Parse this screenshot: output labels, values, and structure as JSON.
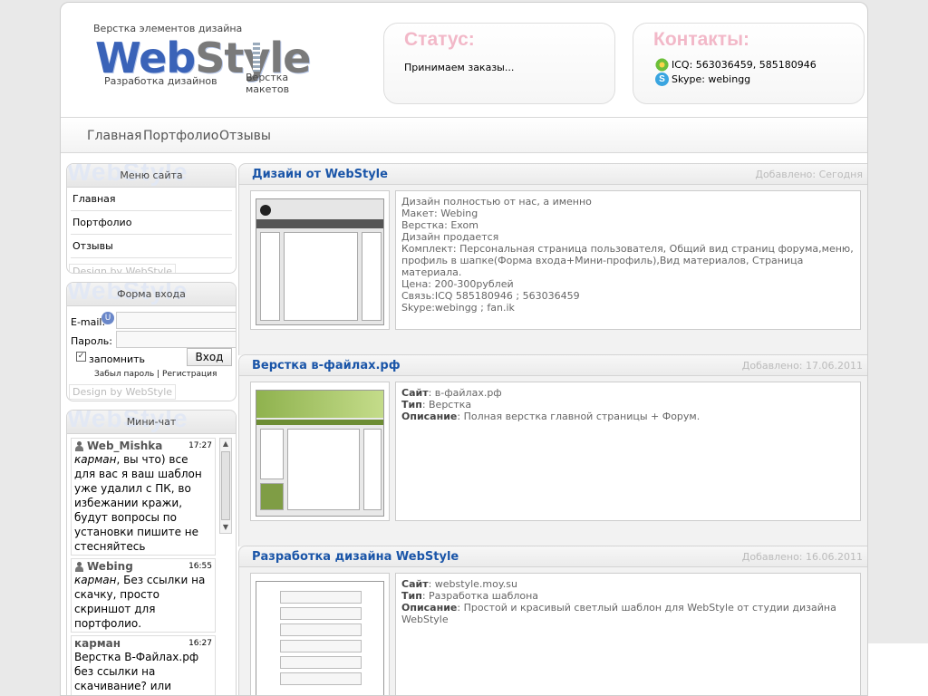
{
  "header": {
    "logo_tag_top": "Верстка элементов дизайна",
    "logo_part1": "Web",
    "logo_part2": "Style",
    "logo_tag_left": "Разработка дизайнов",
    "logo_tag_right": "Верстка макетов",
    "status_title": "Статус:",
    "status_text": "Принимаем заказы...",
    "contacts_title": "Контакты:",
    "contact_icq": "ICQ: 563036459, 585180946",
    "contact_skype": "Skype: webingg"
  },
  "nav": [
    "Главная",
    "Портфолио",
    "Отзывы"
  ],
  "sidebar": {
    "watermark": "WebStyle",
    "menu_title": "Меню сайта",
    "menu_items": [
      "Главная",
      "Портфолио",
      "Отзывы"
    ],
    "design_by": "Design by WebStyle",
    "login_title": "Форма входа",
    "email_label": "E-mail:",
    "password_label": "Пароль:",
    "remember_label": "запомнить",
    "login_button": "Вход",
    "forgot_link": "Забыл пароль",
    "separator": "|",
    "register_link": "Регистрация",
    "chat_title": "Мини-чат",
    "chat": [
      {
        "user": "Web_Mishka",
        "time": "17:27",
        "mention": "карман",
        "text": ", вы что) все для вас я ваш шаблон уже удалил с ПК, во избежании кражи, будут вопросы по установки пишите не стесняйтесь"
      },
      {
        "user": "Webing",
        "time": "16:55",
        "mention": "карман",
        "text": ", Без ссылки на скачку, просто скриншот для портфолио."
      },
      {
        "user": "карман",
        "time": "16:27",
        "mention": "",
        "text": "Верстка В-Файлах.рф без ссылки на скачивание? или просто как портфолио идет?"
      }
    ]
  },
  "entries": [
    {
      "title": "Дизайн от WebStyle",
      "date": "Добавлено: Сегодня",
      "lines": [
        "Дизайн полностью от нас, а именно",
        "Макет: Webing",
        "Верстка: Exom",
        "Дизайн продается",
        "Комплект: Персональная страница пользователя, Общий вид страниц форума,меню, профиль в шапке(Форма входа+Мини-профиль),Вид материалов, Страница материала.",
        "Цена: 200-300рублей",
        "Связь:ICQ 585180946 ; 563036459",
        "Skype:webingg ; fan.ik"
      ]
    },
    {
      "title": "Верстка в-файлах.рф",
      "date": "Добавлено: 17.06.2011",
      "fields": [
        {
          "label": "Сайт",
          "value": "в-файлах.рф"
        },
        {
          "label": "Тип",
          "value": "Верстка"
        },
        {
          "label": "Описание",
          "value": "Полная верстка главной страницы + Форум."
        }
      ]
    },
    {
      "title": "Разработка дизайна WebStyle",
      "date": "Добавлено: 16.06.2011",
      "fields": [
        {
          "label": "Сайт",
          "value": "webstyle.moy.su"
        },
        {
          "label": "Тип",
          "value": "Разработка шаблона"
        },
        {
          "label": "Описание",
          "value": "Простой и красивый светлый шаблон для WebStyle от студии дизайна WebStyle"
        }
      ]
    }
  ]
}
